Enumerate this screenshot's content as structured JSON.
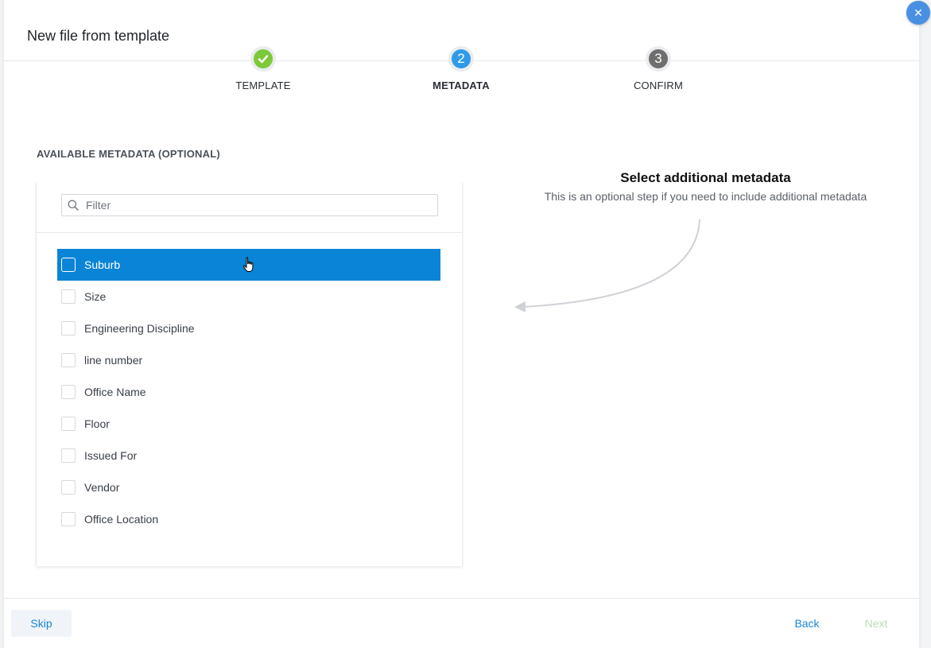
{
  "modal": {
    "title": "New file from template",
    "close_icon": "close-icon"
  },
  "steps": [
    {
      "number": "✓",
      "label": "TEMPLATE",
      "state": "done",
      "color": "#7dc93a"
    },
    {
      "number": "2",
      "label": "METADATA",
      "state": "active",
      "color": "#2f9be8"
    },
    {
      "number": "3",
      "label": "CONFIRM",
      "state": "pending",
      "color": "#6e6e6e"
    }
  ],
  "section": {
    "title": "AVAILABLE METADATA (OPTIONAL)"
  },
  "filter": {
    "placeholder": "Filter",
    "value": "",
    "icon": "search-icon"
  },
  "metadata_items": [
    {
      "label": "Suburb",
      "selected": true,
      "checked": false
    },
    {
      "label": "Size",
      "selected": false,
      "checked": false
    },
    {
      "label": "Engineering Discipline",
      "selected": false,
      "checked": false
    },
    {
      "label": "line number",
      "selected": false,
      "checked": false
    },
    {
      "label": "Office Name",
      "selected": false,
      "checked": false
    },
    {
      "label": "Floor",
      "selected": false,
      "checked": false
    },
    {
      "label": "Issued For",
      "selected": false,
      "checked": false
    },
    {
      "label": "Vendor",
      "selected": false,
      "checked": false
    },
    {
      "label": "Office Location",
      "selected": false,
      "checked": false
    }
  ],
  "hint": {
    "title": "Select additional metadata",
    "subtitle": "This is an optional step if you need to include additional metadata"
  },
  "footer": {
    "skip_label": "Skip",
    "back_label": "Back",
    "next_label": "Next"
  },
  "colors": {
    "accent": "#0a84d6",
    "link": "#1a86d6",
    "disabled": "#b9dcb9"
  }
}
